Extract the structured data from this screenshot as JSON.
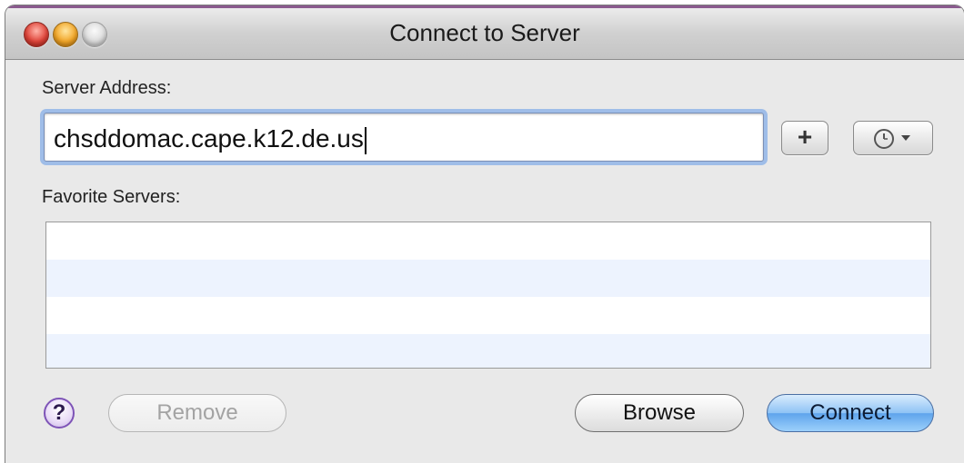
{
  "window": {
    "title": "Connect to Server"
  },
  "server_address": {
    "label": "Server Address:",
    "value": "chsddomac.cape.k12.de.us"
  },
  "buttons": {
    "add_favorite": "+",
    "help": "?",
    "remove": "Remove",
    "browse": "Browse",
    "connect": "Connect"
  },
  "favorites": {
    "label": "Favorite Servers:",
    "items": []
  },
  "icons": {
    "recent_servers": "clock-icon",
    "dropdown": "chevron-down-icon"
  },
  "colors": {
    "connect_accent": "#5fa4ec",
    "focus_ring": "#9fbde8",
    "help_ring": "#7e54b7",
    "list_alt_row": "#edf3fe"
  }
}
